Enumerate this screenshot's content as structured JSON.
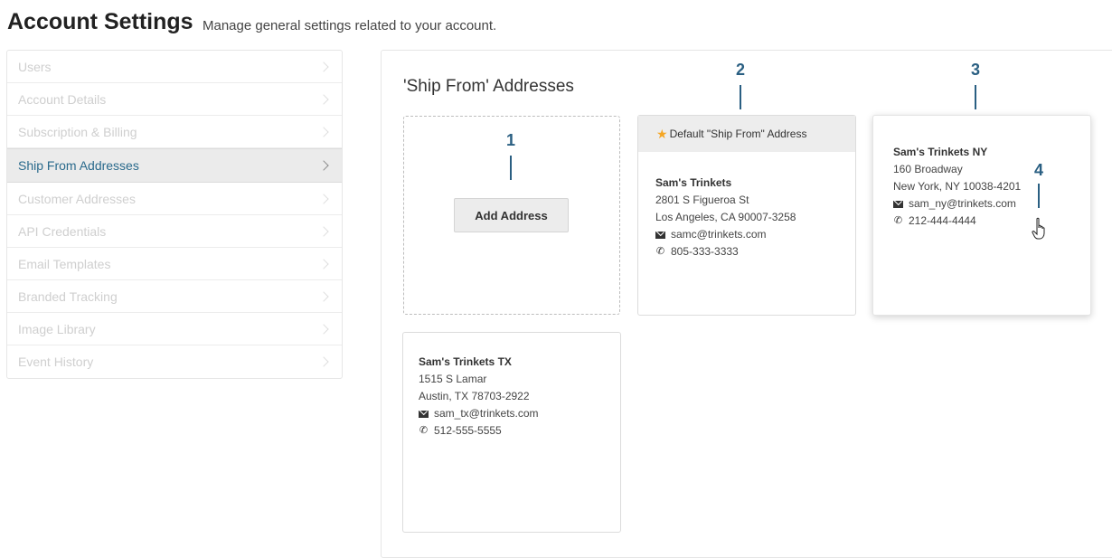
{
  "header": {
    "title": "Account Settings",
    "subtitle": "Manage general settings related to your account."
  },
  "sidebar": {
    "items": [
      {
        "label": "Users",
        "active": false
      },
      {
        "label": "Account Details",
        "active": false
      },
      {
        "label": "Subscription & Billing",
        "active": false
      },
      {
        "label": "Ship From Addresses",
        "active": true
      },
      {
        "label": "Customer Addresses",
        "active": false
      },
      {
        "label": "API Credentials",
        "active": false
      },
      {
        "label": "Email Templates",
        "active": false
      },
      {
        "label": "Branded Tracking",
        "active": false
      },
      {
        "label": "Image Library",
        "active": false
      },
      {
        "label": "Event History",
        "active": false
      }
    ]
  },
  "main": {
    "section_title": "'Ship From' Addresses",
    "add_button_label": "Add Address",
    "default_label": "Default \"Ship From\" Address",
    "addresses": [
      {
        "name": "Sam's Trinkets",
        "street": "2801 S Figueroa St",
        "city": "Los Angeles, CA 90007-3258",
        "email": "samc@trinkets.com",
        "phone": "805-333-3333"
      },
      {
        "name": "Sam's Trinkets NY",
        "street": "160 Broadway",
        "city": "New York, NY 10038-4201",
        "email": "sam_ny@trinkets.com",
        "phone": "212-444-4444"
      },
      {
        "name": "Sam's Trinkets TX",
        "street": "1515 S Lamar",
        "city": "Austin, TX 78703-2922",
        "email": "sam_tx@trinkets.com",
        "phone": "512-555-5555"
      }
    ]
  },
  "callouts": [
    "1",
    "2",
    "3",
    "4"
  ],
  "colors": {
    "accent": "#2a6a8c",
    "callout": "#2a5f82",
    "star": "#f5a623"
  }
}
